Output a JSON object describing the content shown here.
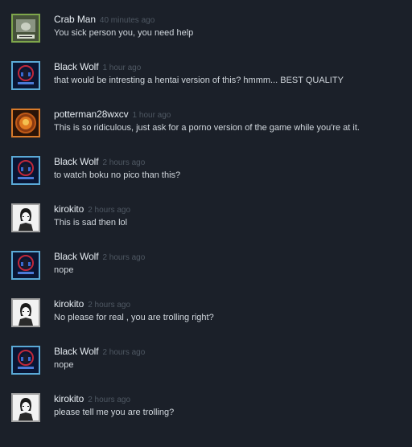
{
  "comments": [
    {
      "author": "Crab Man",
      "time": "40 minutes ago",
      "text": "You sick person you, you need help",
      "avatar": "crab-man-avatar-icon"
    },
    {
      "author": "Black Wolf",
      "time": "1 hour ago",
      "text": "that would be intresting a hentai version of this? hmmm... BEST QUALITY",
      "avatar": "black-wolf-avatar-icon"
    },
    {
      "author": "potterman28wxcv",
      "time": "1 hour ago",
      "text": "This is so ridiculous, just ask for a porno version of the game while you're at it.",
      "avatar": "potterman-avatar-icon"
    },
    {
      "author": "Black Wolf",
      "time": "2 hours ago",
      "text": "to watch boku no pico than this?",
      "avatar": "black-wolf-avatar-icon"
    },
    {
      "author": "kirokito",
      "time": "2 hours ago",
      "text": "This is sad then lol",
      "avatar": "kirokito-avatar-icon"
    },
    {
      "author": "Black Wolf",
      "time": "2 hours ago",
      "text": "nope",
      "avatar": "black-wolf-avatar-icon"
    },
    {
      "author": "kirokito",
      "time": "2 hours ago",
      "text": "No please for real , you are trolling right?",
      "avatar": "kirokito-avatar-icon"
    },
    {
      "author": "Black Wolf",
      "time": "2 hours ago",
      "text": "nope",
      "avatar": "black-wolf-avatar-icon"
    },
    {
      "author": "kirokito",
      "time": "2 hours ago",
      "text": "please tell me you are trolling?",
      "avatar": "kirokito-avatar-icon"
    }
  ],
  "colors": {
    "background": "#1b2029",
    "author": "#e6ecf2",
    "timestamp": "#4f5863",
    "text": "#d1d7dd"
  }
}
